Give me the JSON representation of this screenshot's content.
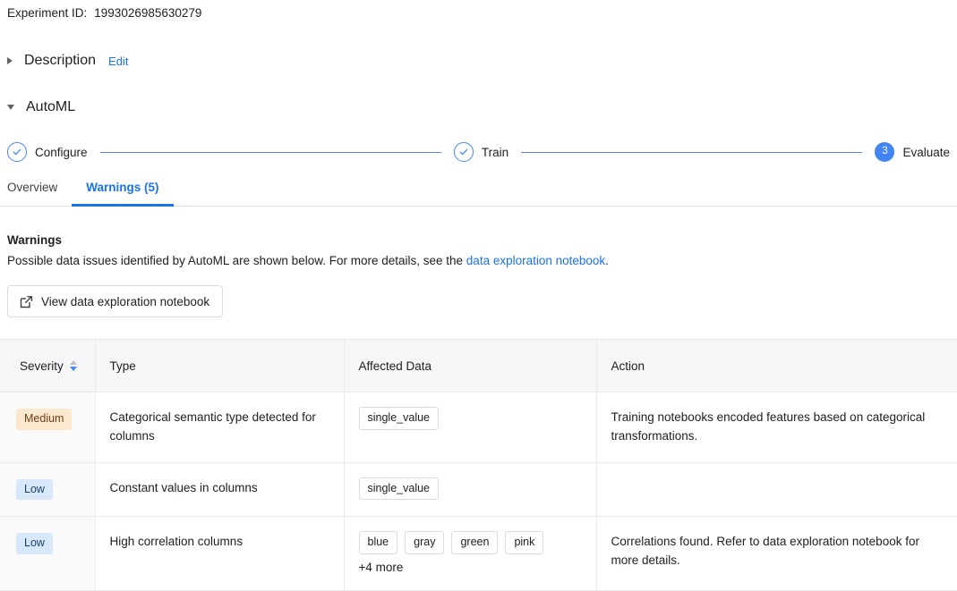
{
  "experiment": {
    "id_label": "Experiment ID:",
    "id_value": "1993026985630279"
  },
  "sections": {
    "description": {
      "title": "Description",
      "edit_label": "Edit",
      "expanded": false
    },
    "automl": {
      "title": "AutoML",
      "expanded": true
    }
  },
  "stepper": {
    "steps": [
      {
        "label": "Configure",
        "state": "done",
        "marker": "check"
      },
      {
        "label": "Train",
        "state": "done",
        "marker": "check"
      },
      {
        "label": "Evaluate",
        "state": "active",
        "marker": "3"
      }
    ]
  },
  "tabs": [
    {
      "label": "Overview",
      "selected": false
    },
    {
      "label": "Warnings (5)",
      "selected": true
    }
  ],
  "warnings_panel": {
    "heading": "Warnings",
    "description_prefix": "Possible data issues identified by AutoML are shown below. For more details, see the ",
    "description_link": "data exploration notebook",
    "description_suffix": ".",
    "notebook_button_label": "View data exploration notebook"
  },
  "table": {
    "columns": [
      {
        "key": "severity",
        "label": "Severity",
        "sortable": true,
        "sort": "desc"
      },
      {
        "key": "type",
        "label": "Type",
        "sortable": false
      },
      {
        "key": "affected_data",
        "label": "Affected Data",
        "sortable": false
      },
      {
        "key": "action",
        "label": "Action",
        "sortable": false
      }
    ],
    "rows": [
      {
        "severity": "Medium",
        "severity_level": "medium",
        "type": "Categorical semantic type detected for columns",
        "chips": [
          "single_value"
        ],
        "more": "",
        "action": "Training notebooks encoded features based on categorical transformations."
      },
      {
        "severity": "Low",
        "severity_level": "low",
        "type": "Constant values in columns",
        "chips": [
          "single_value"
        ],
        "more": "",
        "action": ""
      },
      {
        "severity": "Low",
        "severity_level": "low",
        "type": "High correlation columns",
        "chips": [
          "blue",
          "gray",
          "green",
          "pink"
        ],
        "more": "+4 more",
        "action": "Correlations found. Refer to data exploration notebook for more details."
      }
    ]
  },
  "colors": {
    "accent_blue": "#1a73e8",
    "step_blue": "#4285f4",
    "medium_badge_bg": "#fce8cf",
    "medium_badge_fg": "#6b3f14",
    "low_badge_bg": "#d7e8fb",
    "low_badge_fg": "#1c3f66",
    "border": "#e8eaed",
    "header_bg": "#f5f6f7"
  }
}
